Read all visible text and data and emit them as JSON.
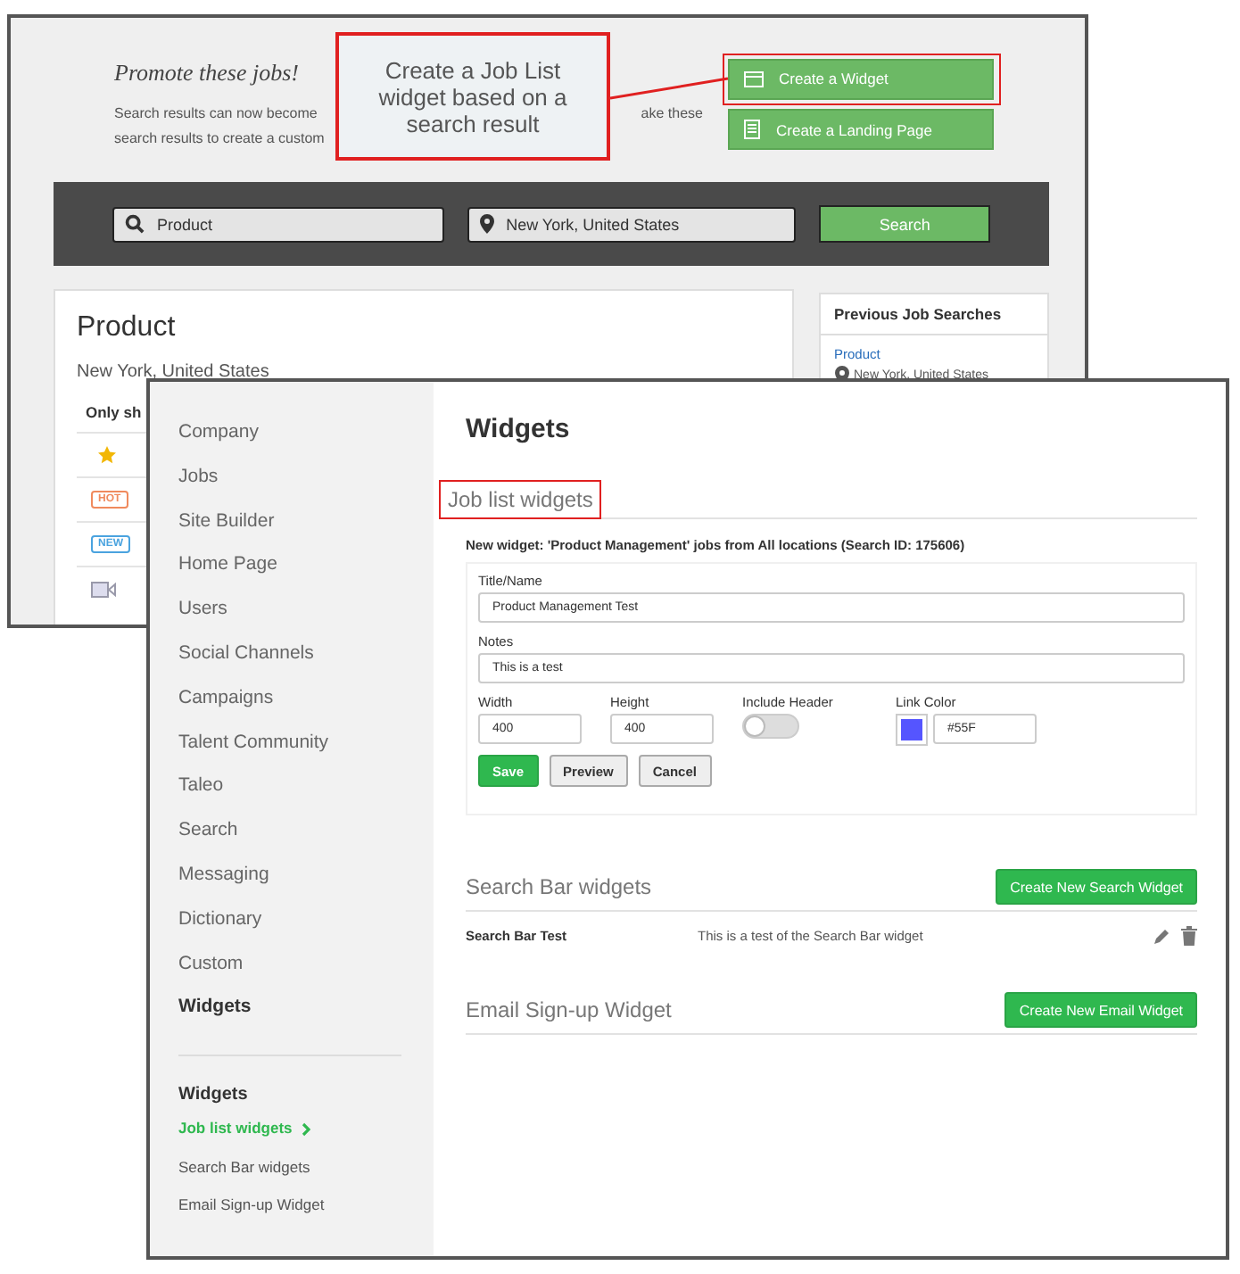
{
  "back_window": {
    "promo_title": "Promote these jobs!",
    "description_fragments": [
      "Search results can now become",
      "ake these",
      "search results to create a custom"
    ],
    "actions": [
      {
        "label": "Create a Widget",
        "kind": "widget",
        "highlighted": true
      },
      {
        "label": "Create a Landing Page",
        "kind": "page",
        "highlighted": false
      }
    ],
    "search_bar": {
      "keyword": "Product",
      "location": "New York, United States",
      "button": "Search"
    },
    "results": {
      "title": "Product",
      "subtitle": "New York, United States",
      "filter_label": "Only sh",
      "rows": [
        {
          "kind": "star"
        },
        {
          "kind": "badge",
          "badge": "HOT",
          "color": "#f08a5d"
        },
        {
          "kind": "badge",
          "badge": "NEW",
          "color": "#4aa3df"
        },
        {
          "kind": "video"
        }
      ]
    },
    "previous_searches": {
      "title": "Previous Job Searches",
      "items": [
        {
          "keyword": "Product",
          "location": "New York, United States"
        }
      ]
    }
  },
  "callout": {
    "text": "Create a Job List widget based on a search result"
  },
  "front_window": {
    "sidebar": {
      "items": [
        {
          "label": "Company",
          "selected": false
        },
        {
          "label": "Jobs",
          "selected": false
        },
        {
          "label": "Site Builder",
          "selected": false
        },
        {
          "label": "Home Page",
          "selected": false
        },
        {
          "label": "Users",
          "selected": false
        },
        {
          "label": "Social Channels",
          "selected": false
        },
        {
          "label": "Campaigns",
          "selected": false
        },
        {
          "label": "Talent Community",
          "selected": false
        },
        {
          "label": "Taleo",
          "selected": false
        },
        {
          "label": "Search",
          "selected": false
        },
        {
          "label": "Messaging",
          "selected": false
        },
        {
          "label": "Dictionary",
          "selected": false
        },
        {
          "label": "Custom",
          "selected": false
        },
        {
          "label": "Widgets",
          "selected": true
        }
      ],
      "subnav_title": "Widgets",
      "subnav": [
        {
          "label": "Job list widgets",
          "selected": true
        },
        {
          "label": "Search Bar widgets",
          "selected": false
        },
        {
          "label": "Email Sign-up Widget",
          "selected": false
        }
      ]
    },
    "title": "Widgets",
    "job_list": {
      "heading": "Job list widgets",
      "highlighted": true,
      "info": "New widget: 'Product Management' jobs from All locations (Search ID: 175606)",
      "form": {
        "title_label": "Title/Name",
        "title_value": "Product Management Test",
        "notes_label": "Notes",
        "notes_value": "This is a test",
        "width_label": "Width",
        "width_value": "400",
        "height_label": "Height",
        "height_value": "400",
        "header_label": "Include Header",
        "header_on": false,
        "color_label": "Link Color",
        "color": "#5555ff",
        "color_value": "#55F",
        "buttons": [
          {
            "label": "Save",
            "kind": "primary"
          },
          {
            "label": "Preview",
            "kind": "default"
          },
          {
            "label": "Cancel",
            "kind": "default"
          }
        ]
      }
    },
    "search_bar_widgets": {
      "heading": "Search Bar widgets",
      "button": "Create New Search Widget",
      "rows": [
        {
          "name": "Search Bar Test",
          "description": "This is a test of the Search Bar widget"
        }
      ]
    },
    "email_widgets": {
      "heading": "Email Sign-up Widget",
      "button": "Create New Email Widget"
    }
  }
}
